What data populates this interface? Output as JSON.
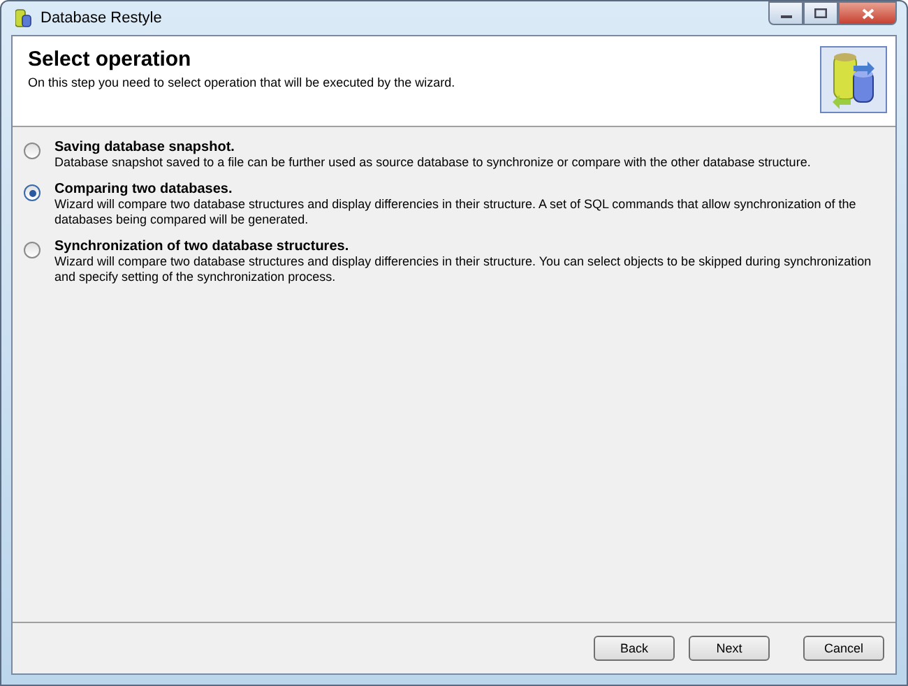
{
  "window": {
    "title": "Database Restyle"
  },
  "header": {
    "title": "Select operation",
    "description": "On this step you need to select operation that will be executed by the wizard."
  },
  "options": [
    {
      "title": "Saving database snapshot.",
      "description": "Database snapshot saved to a file can be further used as source database to synchronize or compare with the other database structure.",
      "selected": false
    },
    {
      "title": "Comparing two databases.",
      "description": "Wizard will compare two database structures and display differencies in their structure. A set of SQL commands that allow synchronization of the databases being compared will be generated.",
      "selected": true
    },
    {
      "title": "Synchronization of two database structures.",
      "description": "Wizard will compare two database structures and display differencies in their structure. You can select objects to be skipped during synchronization and specify setting of the synchronization process.",
      "selected": false
    }
  ],
  "buttons": [
    "Back",
    "Next",
    "Cancel"
  ]
}
